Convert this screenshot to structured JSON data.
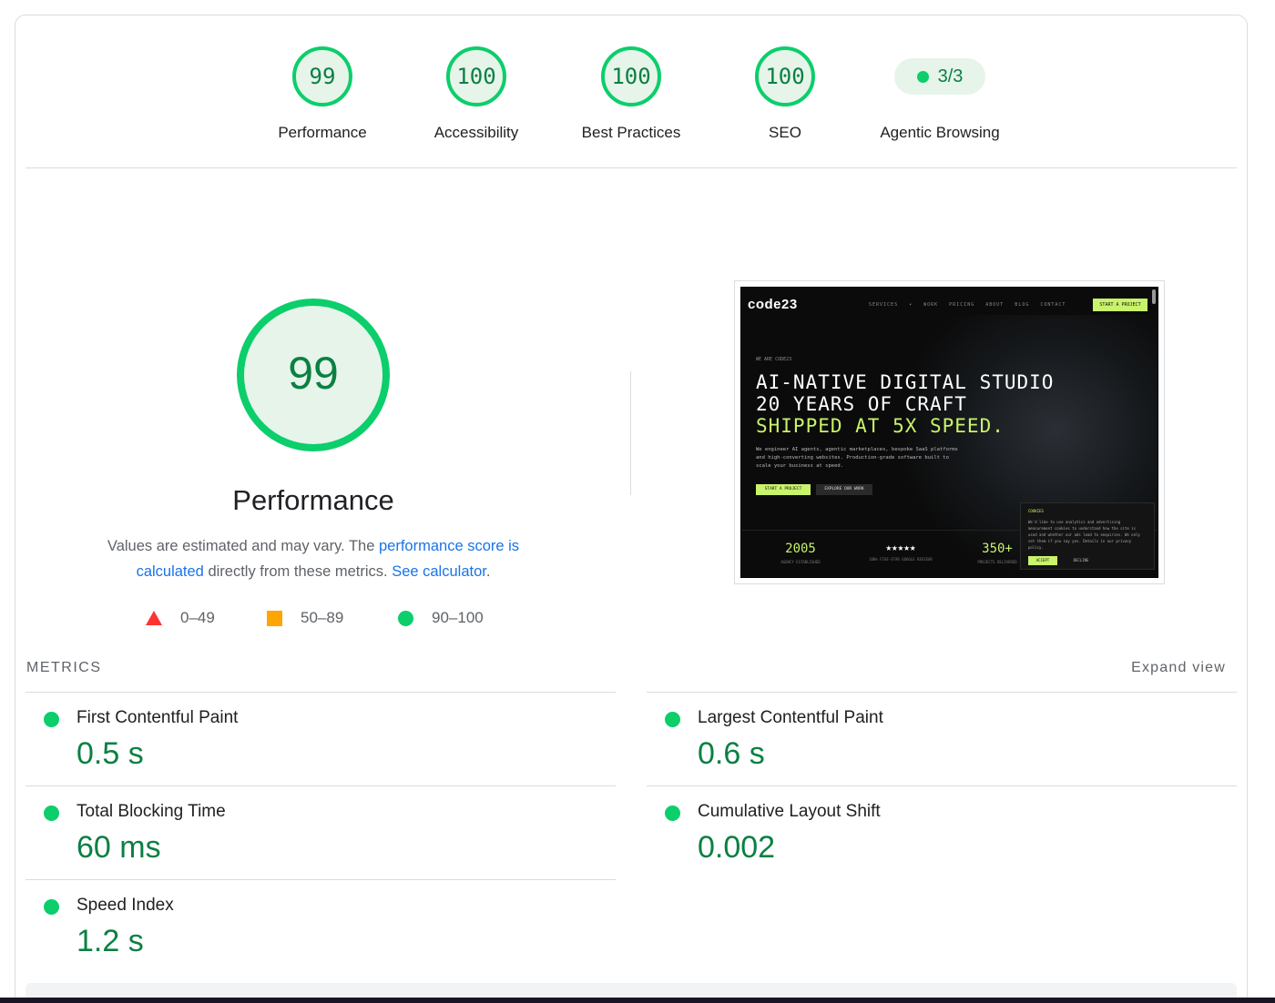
{
  "categories": [
    {
      "score": "99",
      "label": "Performance"
    },
    {
      "score": "100",
      "label": "Accessibility"
    },
    {
      "score": "100",
      "label": "Best Practices"
    },
    {
      "score": "100",
      "label": "SEO"
    }
  ],
  "agentic": {
    "score": "3/3",
    "label": "Agentic Browsing"
  },
  "performance": {
    "score": "99",
    "title": "Performance",
    "desc_prefix": "Values are estimated and may vary. The ",
    "score_link": "performance score is calculated",
    "desc_middle": " directly from these metrics. ",
    "calc_link": "See calculator",
    "desc_suffix": "."
  },
  "legend": [
    {
      "range": "0–49",
      "shape": "triangle",
      "color": "#ff3333"
    },
    {
      "range": "50–89",
      "shape": "square",
      "color": "#ffa400"
    },
    {
      "range": "90–100",
      "shape": "circle",
      "color": "#0cce6b"
    }
  ],
  "screenshot": {
    "logo": "code23",
    "nav": "SERVICES ▾ WORK PRICING ABOUT BLOG CONTACT",
    "cta": "START A PROJECT",
    "eyebrow": "WE ARE CODE23",
    "headline_1": "AI-NATIVE DIGITAL STUDIO",
    "headline_2": "20 YEARS OF CRAFT",
    "headline_3": "SHIPPED AT 5X SPEED.",
    "subtext": "We engineer AI agents, agentic marketplaces, bespoke SaaS platforms and high-converting websites. Production-grade software built to scale your business at speed.",
    "btn_primary": "START A PROJECT",
    "btn_secondary": "EXPLORE OUR WORK",
    "stat_1": "2005",
    "stat_1_caption": "AGENCY ESTABLISHED",
    "stat_2": "★★★★★",
    "stat_2_caption": "100% FIVE-STAR GOOGLE REVIEWS",
    "stat_3": "350+",
    "stat_3_caption": "PROJECTS DELIVERED",
    "cookie_title": "COOKIES",
    "cookie_body": "We'd like to use analytics and advertising measurement cookies to understand how the site is used and whether our ads lead to enquiries. We only set them if you say yes. Details in our privacy policy.",
    "cookie_accept": "ACCEPT",
    "cookie_decline": "DECLINE"
  },
  "metrics_header": "METRICS",
  "expand_label": "Expand view",
  "metrics": [
    {
      "name": "First Contentful Paint",
      "value": "0.5 s",
      "status": "pass"
    },
    {
      "name": "Largest Contentful Paint",
      "value": "0.6 s",
      "status": "pass"
    },
    {
      "name": "Total Blocking Time",
      "value": "60 ms",
      "status": "pass"
    },
    {
      "name": "Cumulative Layout Shift",
      "value": "0.002",
      "status": "pass"
    },
    {
      "name": "Speed Index",
      "value": "1.2 s",
      "status": "pass"
    }
  ],
  "colors": {
    "pass": "#0cce6b",
    "pass_text": "#0b8043",
    "pass_bg": "#e6f4ea",
    "link": "#1a73e8"
  }
}
